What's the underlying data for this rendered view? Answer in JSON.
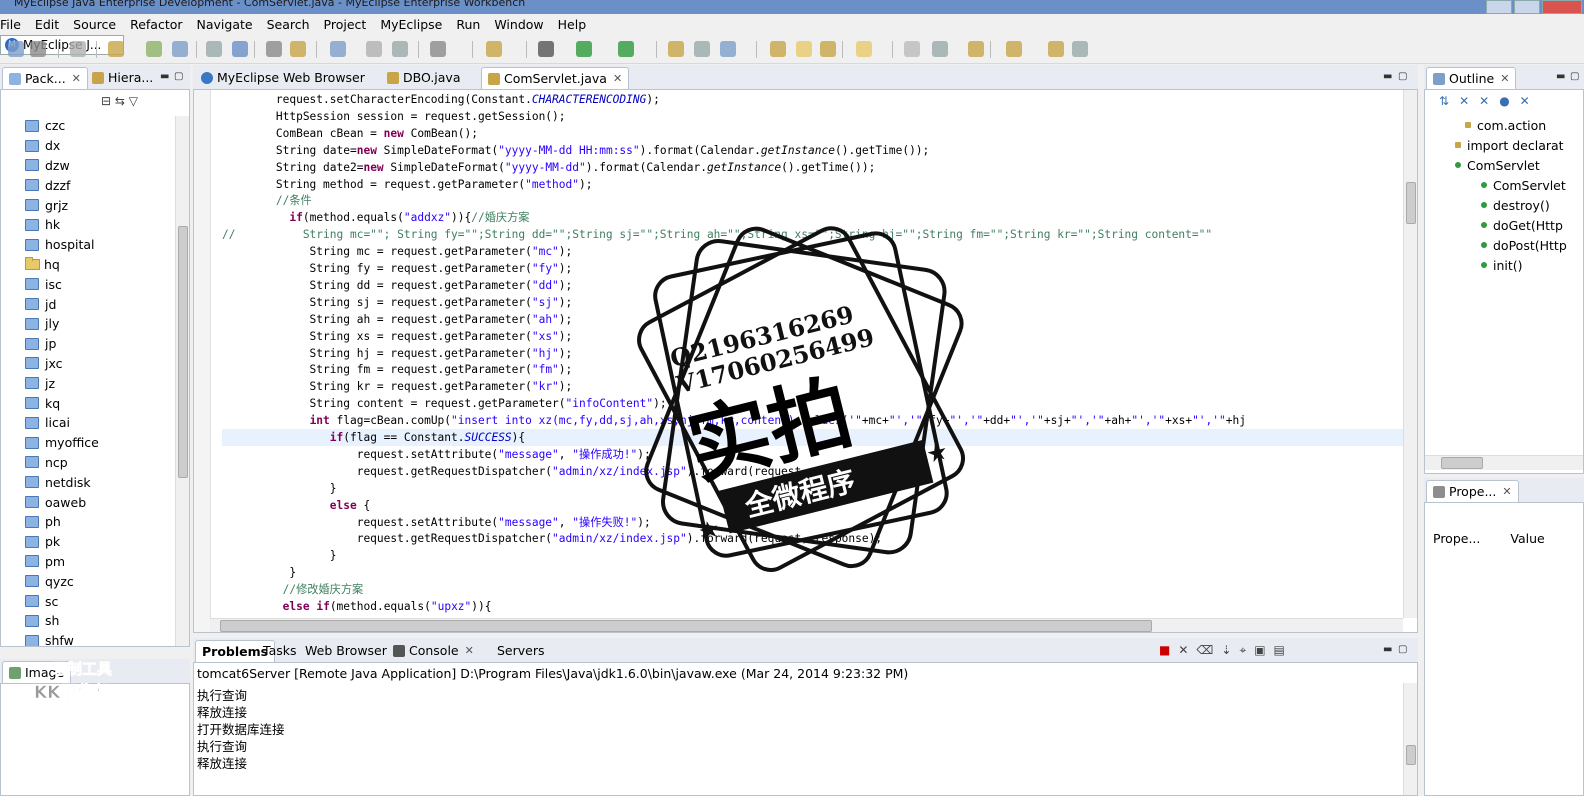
{
  "window": {
    "title": "MyEclipse Java Enterprise Development - ComServlet.java - MyEclipse Enterprise Workbench"
  },
  "menu": [
    "File",
    "Edit",
    "Source",
    "Refactor",
    "Navigate",
    "Search",
    "Project",
    "MyEclipse",
    "Run",
    "Window",
    "Help"
  ],
  "perspective": {
    "label": "MyEclipse J..."
  },
  "left_view": {
    "tabs": [
      "Pack...",
      "Hiera..."
    ],
    "items": [
      "czc",
      "dx",
      "dzw",
      "dzzf",
      "grjz",
      "hk",
      "hospital",
      "hq",
      "isc",
      "jd",
      "jly",
      "jp",
      "jxc",
      "jz",
      "kq",
      "licai",
      "myoffice",
      "ncp",
      "netdisk",
      "oaweb",
      "ph",
      "pk",
      "pm",
      "qyzc",
      "sc",
      "sh",
      "shfw"
    ]
  },
  "left_bottom_view": {
    "tab": "Image"
  },
  "editor": {
    "tabs": [
      "MyEclipse Web Browser",
      "DBO.java",
      "ComServlet.java"
    ],
    "lines": [
      "        request.setCharacterEncoding(Constant.CHARACTERENCODING);",
      "        HttpSession session = request.getSession();",
      "        ComBean cBean = new ComBean();",
      "        String date=new SimpleDateFormat(\"yyyy-MM-dd HH:mm:ss\").format(Calendar.getInstance().getTime());",
      "        String date2=new SimpleDateFormat(\"yyyy-MM-dd\").format(Calendar.getInstance().getTime());",
      "        String method = request.getParameter(\"method\");",
      "        //条件",
      "          if(method.equals(\"addxz\")){//婚庆方案",
      "//          String mc=\"\"; String fy=\"\";String dd=\"\";String sj=\"\";String ah=\"\";String xs=\"\";String hj=\"\";String fm=\"\";String kr=\"\";String content=\"\"",
      "             String mc = request.getParameter(\"mc\");",
      "             String fy = request.getParameter(\"fy\");",
      "             String dd = request.getParameter(\"dd\");",
      "             String sj = request.getParameter(\"sj\");",
      "             String ah = request.getParameter(\"ah\");",
      "             String xs = request.getParameter(\"xs\");",
      "             String hj = request.getParameter(\"hj\");",
      "             String fm = request.getParameter(\"fm\");",
      "             String kr = request.getParameter(\"kr\");",
      "             String content = request.getParameter(\"infoContent\");",
      "             int flag=cBean.comUp(\"insert into xz(mc,fy,dd,sj,ah,xs,hj,fm,kr,content) values('\"+mc+\"','\"+fy+\"','\"+dd+\"','\"+sj+\"','\"+ah+\"','\"+xs+\"','\"+hj",
      "                if(flag == Constant.SUCCESS){",
      "                    request.setAttribute(\"message\", \"操作成功!\");",
      "                    request.getRequestDispatcher(\"admin/xz/index.jsp\").forward(request, response);",
      "                }",
      "                else {",
      "                    request.setAttribute(\"message\", \"操作失败!\");",
      "                    request.getRequestDispatcher(\"admin/xz/index.jsp\").forward(request, response);",
      "                }",
      "          }",
      "         //修改婚庆方案",
      "         else if(method.equals(\"upxz\")){"
    ]
  },
  "outline": {
    "tab": "Outline",
    "items": [
      "com.action",
      "import declarat",
      "ComServlet",
      "ComServlet",
      "destroy()",
      "doGet(Http",
      "doPost(Http",
      "init()"
    ]
  },
  "properties": {
    "tab": "Prope...",
    "col1": "Prope...",
    "col2": "Value"
  },
  "console": {
    "tabs": [
      "Problems",
      "Tasks",
      "Web Browser",
      "Console",
      "Servers"
    ],
    "header": "tomcat6Server [Remote Java Application] D:\\Program Files\\Java\\jdk1.6.0\\bin\\javaw.exe (Mar 24, 2014 9:23:32 PM)",
    "lines": [
      "执行查询",
      "释放连接",
      "打开数据库连接",
      "执行查询",
      "释放连接"
    ]
  },
  "watermark": {
    "line1": "Q2196316269",
    "line2": "V17060256499",
    "big": "实拍",
    "banner": "全微程序"
  },
  "watermark_corner": {
    "line1": "录制工具",
    "line2": "KK录像机"
  },
  "colors": {
    "comment": "#3f7f5f",
    "string": "#2a00ff",
    "keyword": "#7f0055",
    "field": "#0000c0"
  }
}
